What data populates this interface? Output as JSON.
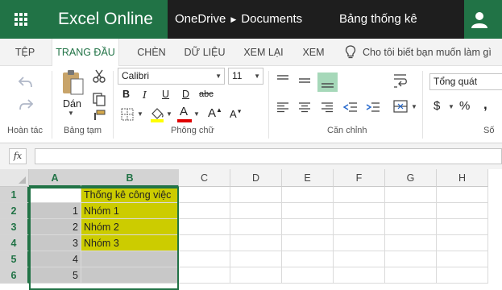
{
  "app": {
    "name": "Excel Online",
    "brand_color": "#217346"
  },
  "breadcrumb": {
    "root": "OneDrive",
    "folder": "Documents"
  },
  "document": {
    "title": "Bảng thống kê"
  },
  "icons": {
    "app_launcher": "waffle-icon",
    "user": "user-icon",
    "tell_me": "lightbulb-icon"
  },
  "tabs": [
    {
      "label": "TỆP",
      "active": false
    },
    {
      "label": "TRANG ĐẦU",
      "active": true
    },
    {
      "label": "CHÈN",
      "active": false
    },
    {
      "label": "DỮ LIỆU",
      "active": false
    },
    {
      "label": "XEM LẠI",
      "active": false
    },
    {
      "label": "XEM",
      "active": false
    }
  ],
  "tell_me": {
    "placeholder": "Cho tôi biết bạn muốn làm gì"
  },
  "ribbon": {
    "groups": {
      "undo": "Hoàn tác",
      "clipboard": "Bảng tạm",
      "font": "Phông chữ",
      "alignment": "Căn chỉnh",
      "number": "Số"
    },
    "paste_label": "Dán",
    "font_name": "Calibri",
    "font_size": "11",
    "bold": "B",
    "italic": "I",
    "underline": "U",
    "double_underline": "D",
    "strikethrough": "abc",
    "font_color_letter": "A",
    "number_format": "Tổng quát",
    "currency_symbol": "$",
    "percent_symbol": "%",
    "comma_symbol": ","
  },
  "formula_bar": {
    "fx_label": "fx",
    "value": ""
  },
  "sheet": {
    "columns": [
      "A",
      "B",
      "C",
      "D",
      "E",
      "F",
      "G",
      "H"
    ],
    "rows": [
      "1",
      "2",
      "3",
      "4",
      "5",
      "6"
    ],
    "fill_gray": "#c8c8c8",
    "fill_yellow": "#cccc00",
    "cells": {
      "A1": "",
      "B1": "Thống kê công việc",
      "A2": "1",
      "B2": "Nhóm 1",
      "A3": "2",
      "B3": "Nhóm 2",
      "A4": "3",
      "B4": "Nhóm 3",
      "A5": "4",
      "B5": "",
      "A6": "5",
      "B6": ""
    }
  }
}
